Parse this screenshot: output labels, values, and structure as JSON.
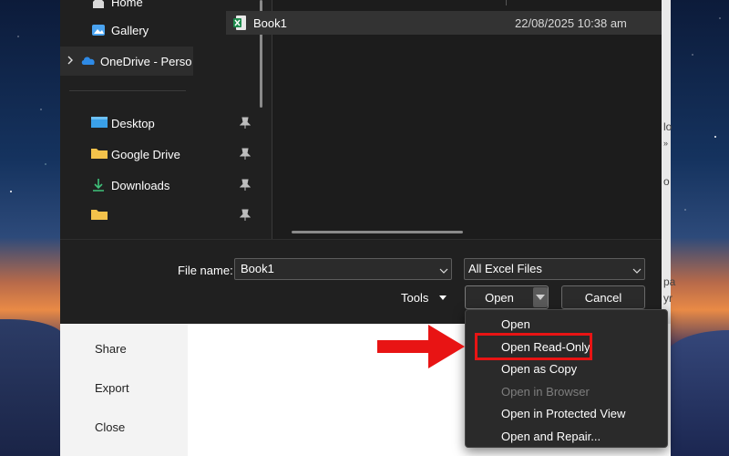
{
  "sidebar": {
    "items": [
      {
        "label": "Home",
        "icon": "home-icon"
      },
      {
        "label": "Gallery",
        "icon": "gallery-icon"
      },
      {
        "label": "OneDrive - Perso",
        "icon": "onedrive-icon",
        "expandable": true
      },
      {
        "label": "Desktop",
        "icon": "desktop-icon",
        "pinned": true
      },
      {
        "label": "Google Drive",
        "icon": "folder-icon",
        "pinned": true
      },
      {
        "label": "Downloads",
        "icon": "download-icon",
        "pinned": true
      },
      {
        "label": "",
        "icon": "folder-icon",
        "pinned": true
      }
    ]
  },
  "file_list": {
    "rows": [
      {
        "name": "Book1",
        "modified": "22/08/2025 10:38 am",
        "icon": "excel-file-icon"
      }
    ]
  },
  "bottom": {
    "file_name_label": "File name:",
    "file_name_value": "Book1",
    "filter_value": "All Excel Files",
    "tools_label": "Tools",
    "open_label": "Open",
    "cancel_label": "Cancel"
  },
  "open_menu": {
    "items": [
      {
        "label": "Open",
        "enabled": true
      },
      {
        "label": "Open Read-Only",
        "enabled": true,
        "highlighted": true
      },
      {
        "label": "Open as Copy",
        "enabled": true
      },
      {
        "label": "Open in Browser",
        "enabled": false
      },
      {
        "label": "Open in Protected View",
        "enabled": true
      },
      {
        "label": "Open and Repair...",
        "enabled": true
      }
    ]
  },
  "backstage": {
    "items": [
      "Share",
      "Export",
      "Close"
    ]
  },
  "background_edge_text": [
    "lo",
    "»",
    "o",
    "pa",
    "yr"
  ],
  "colors": {
    "highlight": "#e81414",
    "arrow": "#e81414",
    "dialog_bg": "#202020",
    "excel_green": "#1d8a4c"
  }
}
